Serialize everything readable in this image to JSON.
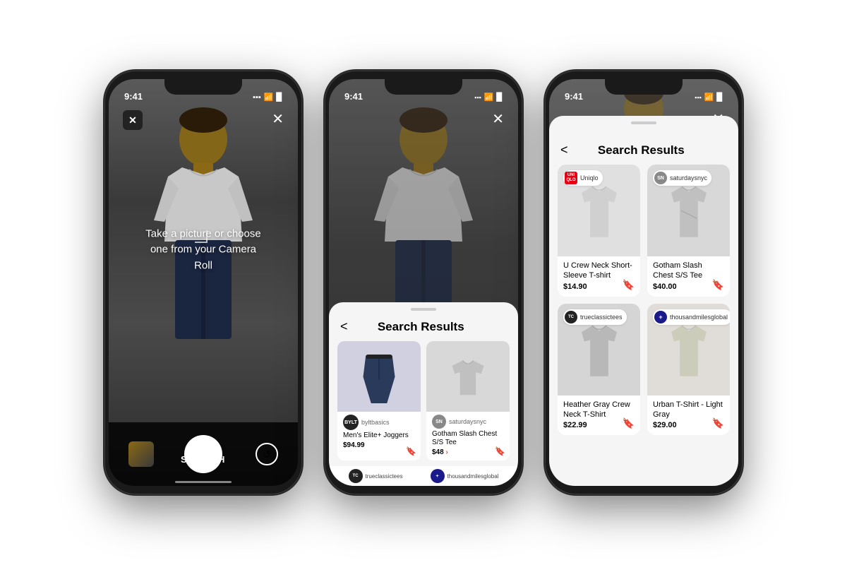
{
  "phones": [
    {
      "id": "phone1",
      "statusBar": {
        "time": "9:41"
      },
      "screen": "camera",
      "cameraText": "Take a picture or\nchoose one from your\nCamera Roll",
      "searchLabel": "SEARCH"
    },
    {
      "id": "phone2",
      "statusBar": {
        "time": "9:41"
      },
      "screen": "search-results-partial",
      "sheetTitle": "Search Results",
      "products": [
        {
          "brand": "BYLT",
          "brandFull": "byltbasics",
          "name": "Men's Elite+ Joggers",
          "price": "$94.99",
          "type": "joggers"
        },
        {
          "brand": "SN",
          "brandFull": "saturdaysnyc",
          "name": "Gotham Slash Chest S/S Tee",
          "price": "$48",
          "type": "tshirt-gray",
          "priceArrow": true
        }
      ],
      "brandStrip": [
        "trueclassictees",
        "thousandmilesglobal"
      ]
    },
    {
      "id": "phone3",
      "statusBar": {
        "time": "9:41"
      },
      "screen": "search-results-full",
      "sheetTitle": "Search Results",
      "products": [
        {
          "brand": "UNIQLO",
          "brandFull": "Uniqlo",
          "brandType": "uniqlo",
          "name": "U Crew Neck Short-Sleeve T-shirt",
          "price": "$14.90",
          "type": "tshirt-light"
        },
        {
          "brand": "SN",
          "brandFull": "saturdaysnyc",
          "brandType": "saturdays",
          "name": "Gotham Slash Chest S/S Tee",
          "price": "$40.00",
          "type": "tshirt-gray"
        },
        {
          "brand": "TC",
          "brandFull": "trueclassictees",
          "brandType": "trueclassic",
          "name": "Heather Gray Crew Neck T-Shirt",
          "price": "$22.99",
          "type": "tshirt-med"
        },
        {
          "brand": "+",
          "brandFull": "thousandmilesglobal",
          "brandType": "thousandmiles",
          "name": "Urban T-Shirt - Light Gray",
          "price": "$29.00",
          "type": "tshirt-light2"
        }
      ]
    }
  ]
}
